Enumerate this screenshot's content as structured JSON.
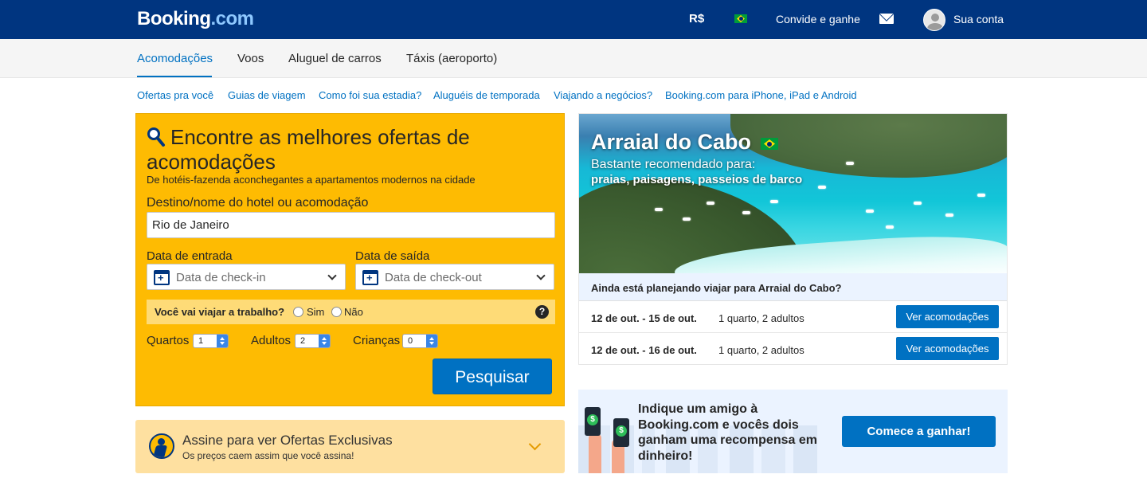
{
  "header": {
    "logo": "Booking",
    "logo_suffix": ".com",
    "currency": "R$",
    "invite": "Convide e ganhe",
    "account": "Sua conta"
  },
  "tabs": [
    {
      "label": "Acomodações",
      "active": true
    },
    {
      "label": "Voos"
    },
    {
      "label": "Aluguel de carros"
    },
    {
      "label": "Táxis (aeroporto)"
    }
  ],
  "sublinks": [
    "Ofertas pra você",
    "Guias de viagem",
    "Como foi sua estadia?",
    "Aluguéis de temporada",
    "Viajando a negócios?",
    "Booking.com para iPhone, iPad e Android"
  ],
  "search": {
    "title": "Encontre as melhores ofertas de acomodações",
    "subtitle": "De hotéis-fazenda aconchegantes a apartamentos modernos na cidade",
    "dest_label": "Destino/nome do hotel ou acomodação",
    "dest_value": "Rio de Janeiro",
    "checkin_label": "Data de entrada",
    "checkin_placeholder": "Data de check-in",
    "checkout_label": "Data de saída",
    "checkout_placeholder": "Data de check-out",
    "work_question": "Você vai viajar a trabalho?",
    "work_yes": "Sim",
    "work_no": "Não",
    "help": "?",
    "rooms_label": "Quartos",
    "rooms_value": "1",
    "adults_label": "Adultos",
    "adults_value": "2",
    "children_label": "Crianças",
    "children_value": "0",
    "button": "Pesquisar"
  },
  "subscribe": {
    "title": "Assine para ver Ofertas Exclusivas",
    "text": "Os preços caem assim que você assina!"
  },
  "destination": {
    "name": "Arraial do Cabo",
    "recommended": "Bastante recomendado para:",
    "tags": "praias, paisagens, passeios de barco",
    "planning": "Ainda está planejando viajar para Arraial do Cabo?",
    "stays": [
      {
        "dates": "12 de out. - 15 de out.",
        "rooms": "1 quarto, 2 adultos",
        "button": "Ver acomodações"
      },
      {
        "dates": "12 de out. - 16 de out.",
        "rooms": "1 quarto, 2 adultos",
        "button": "Ver acomodações"
      }
    ]
  },
  "referral": {
    "text": "Indique um amigo à Booking.com e vocês dois ganham uma recompensa em dinheiro!",
    "button": "Comece a ganhar!"
  },
  "colors": {
    "brand_blue": "#003580",
    "action_blue": "#0071c2",
    "search_yellow": "#febb02"
  }
}
